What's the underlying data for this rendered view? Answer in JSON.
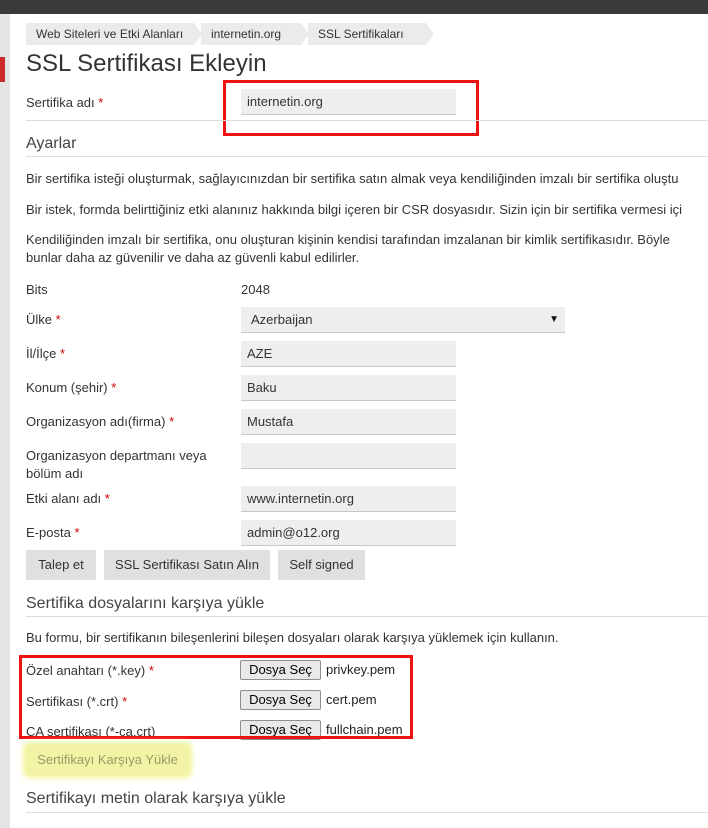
{
  "breadcrumb": [
    "Web Siteleri ve Etki Alanları",
    "internetin.org",
    "SSL Sertifikaları"
  ],
  "page_title": "SSL Sertifikası Ekleyin",
  "required_mark": "*",
  "certificate_name": {
    "label": "Sertifika adı",
    "value": "internetin.org"
  },
  "settings": {
    "title": "Ayarlar",
    "para1": "Bir sertifika isteği oluşturmak, sağlayıcınızdan bir sertifika satın almak veya kendiliğinden imzalı bir sertifika oluştu",
    "para2": "Bir istek, formda belirttiğiniz etki alanınız hakkında bilgi içeren bir CSR dosyasıdır. Sizin için bir sertifika vermesi içi",
    "para3_line1": "Kendiliğinden imzalı bir sertifika, onu oluşturan kişinin kendisi tarafından imzalanan bir kimlik sertifikasıdır. Böyle",
    "para3_line2": "bunlar daha az güvenilir ve daha az güvenli kabul edilirler.",
    "bits": {
      "label": "Bits",
      "value": "2048"
    },
    "country": {
      "label": "Ülke",
      "value": "Azerbaijan"
    },
    "state": {
      "label": "İl/İlçe",
      "value": "AZE"
    },
    "city": {
      "label": "Konum (şehir)",
      "value": "Baku"
    },
    "organization": {
      "label": "Organizasyon adı(firma)",
      "value": "Mustafa"
    },
    "department": {
      "label_line1": "Organizasyon departmanı veya",
      "label_line2": "bölüm adı",
      "value": ""
    },
    "domain": {
      "label": "Etki alanı adı",
      "value": "www.internetin.org"
    },
    "email": {
      "label": "E-posta",
      "value": "admin@o12.org"
    },
    "buttons": {
      "request": "Talep et",
      "buy": "SSL Sertifikası Satın Alın",
      "self_signed": "Self signed"
    }
  },
  "upload_files": {
    "title": "Sertifika dosyalarını karşıya yükle",
    "description": "Bu formu, bir sertifikanın bileşenlerini bileşen dosyaları olarak karşıya yüklemek için kullanın.",
    "choose_label": "Dosya Seç",
    "private_key": {
      "label": "Özel anahtarı (*.key)",
      "file": "privkey.pem"
    },
    "certificate": {
      "label": "Sertifikası (*.crt)",
      "file": "cert.pem"
    },
    "ca_certificate": {
      "label": "CA sertifikası (*-ca.crt)",
      "file": "fullchain.pem"
    },
    "upload_button": "Sertifikayı Karşıya Yükle"
  },
  "upload_text": {
    "title": "Sertifikayı metin olarak karşıya yükle"
  },
  "colors": {
    "highlight_red": "#ee1111",
    "upload_highlight": "#f3f3a6",
    "required": "#cc0000"
  }
}
